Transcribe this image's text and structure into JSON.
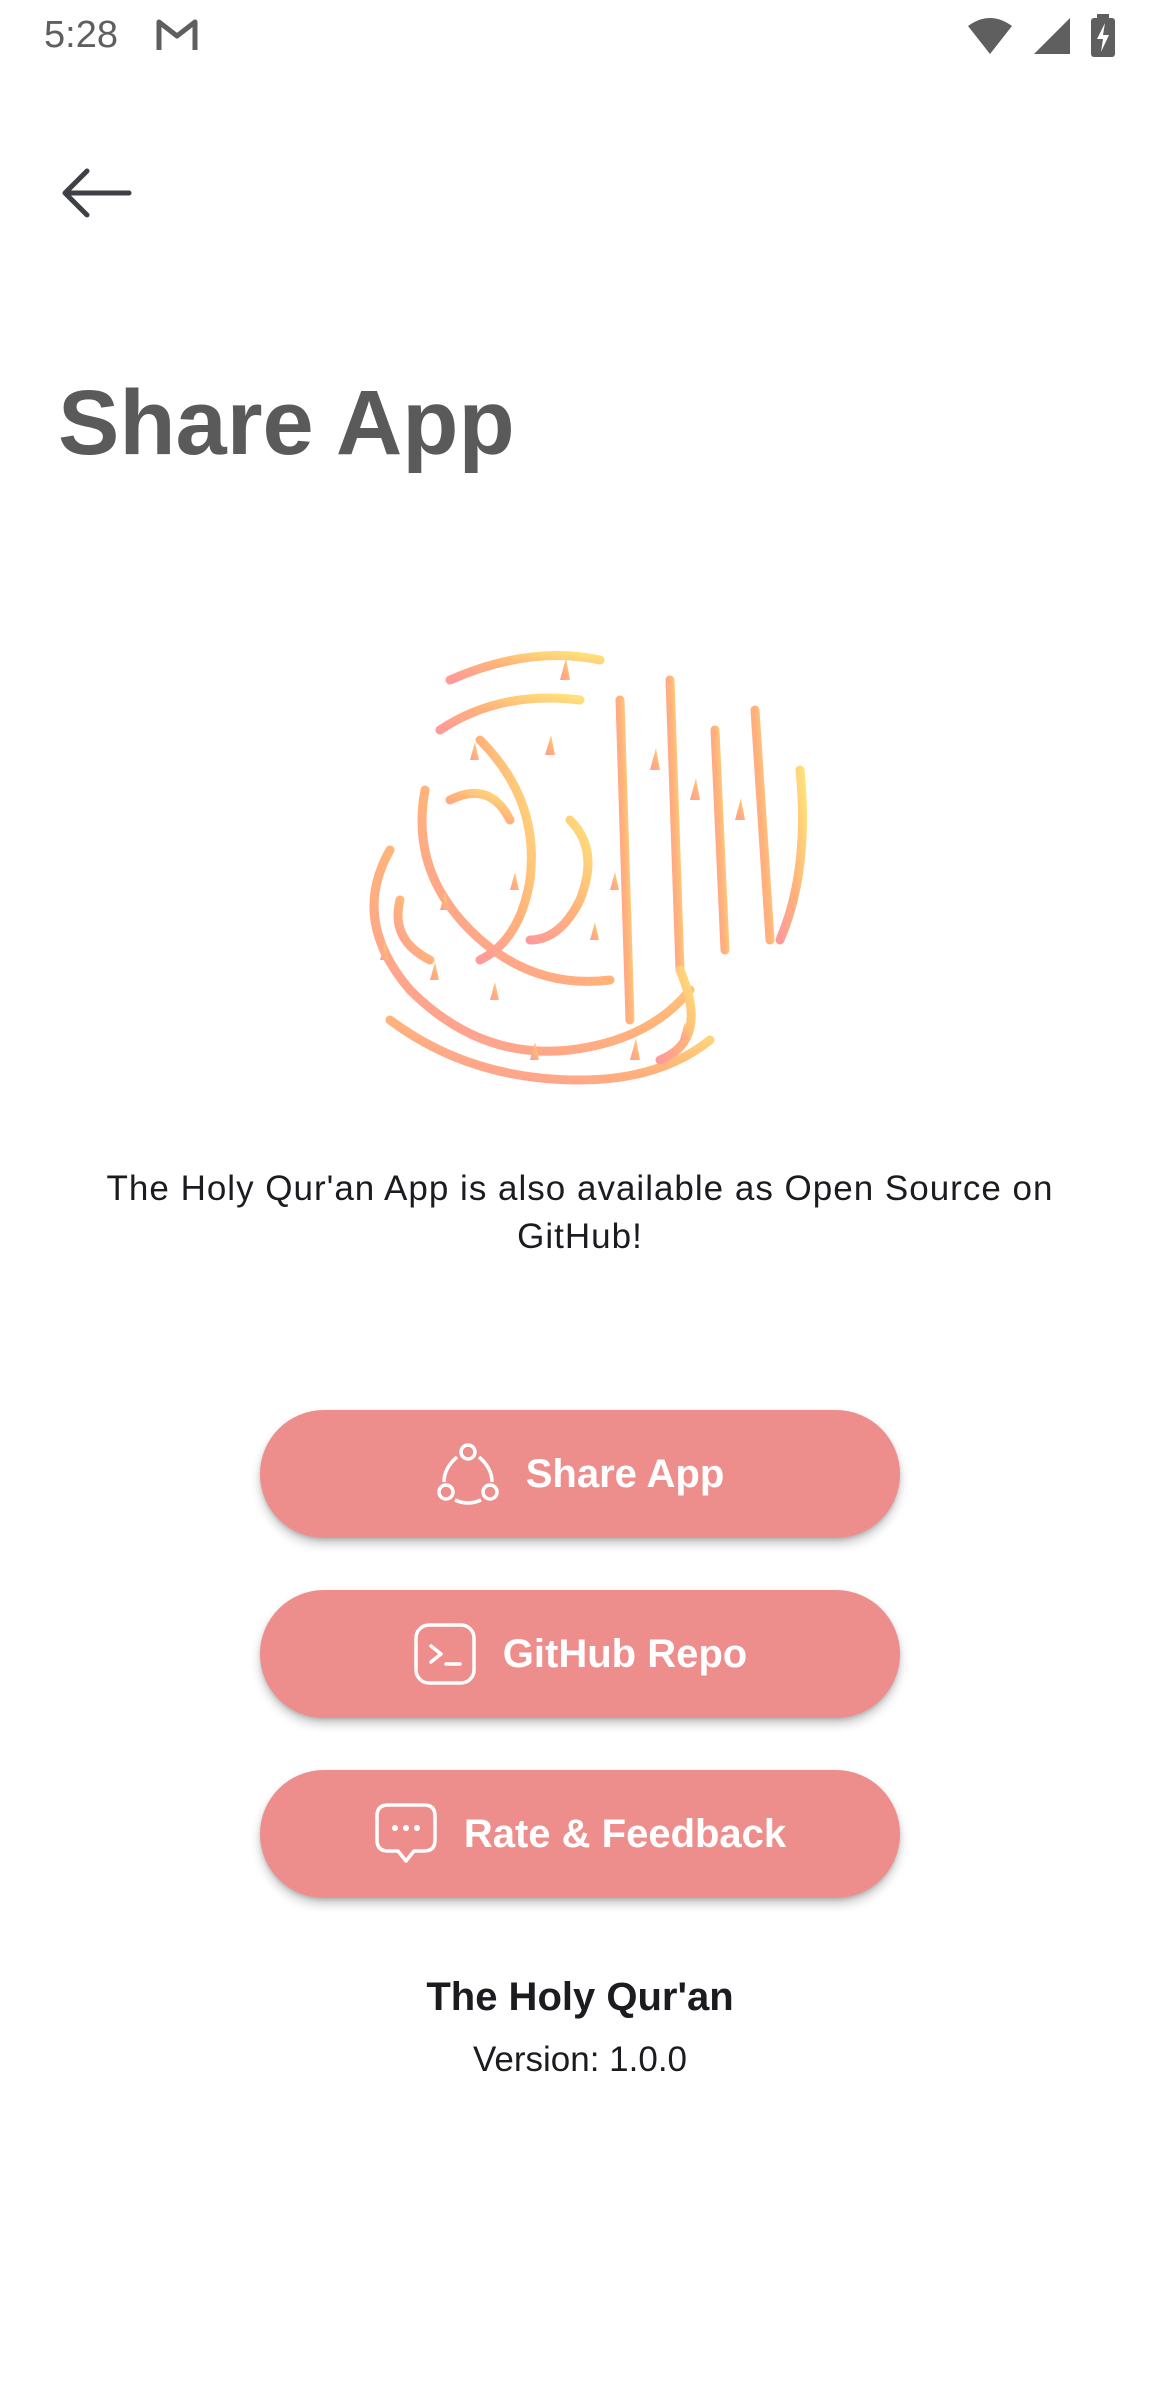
{
  "status_bar": {
    "time": "5:28",
    "notification_icon": "gmail-icon",
    "icons": [
      "wifi-icon",
      "cell-signal-icon",
      "battery-charging-icon"
    ]
  },
  "toolbar": {
    "back_icon": "arrow-back-icon"
  },
  "page": {
    "title": "Share App"
  },
  "logo": {
    "icon": "quran-calligraphy-logo",
    "gradient_colors": [
      "#ffe17a",
      "#ffb37a",
      "#ff9a9a"
    ]
  },
  "description": "The Holy Qur'an App is also available as Open Source on GitHub!",
  "buttons": {
    "share": {
      "label": "Share App",
      "icon": "share-icon"
    },
    "github": {
      "label": "GitHub Repo",
      "icon": "terminal-icon"
    },
    "rate": {
      "label": "Rate & Feedback",
      "icon": "chat-bubble-icon"
    }
  },
  "colors": {
    "button_bg": "#ee8e8c",
    "button_text": "#ffffff",
    "title": "#5a5a5a"
  },
  "footer": {
    "app_name": "The Holy Qur'an",
    "version": "Version: 1.0.0"
  }
}
